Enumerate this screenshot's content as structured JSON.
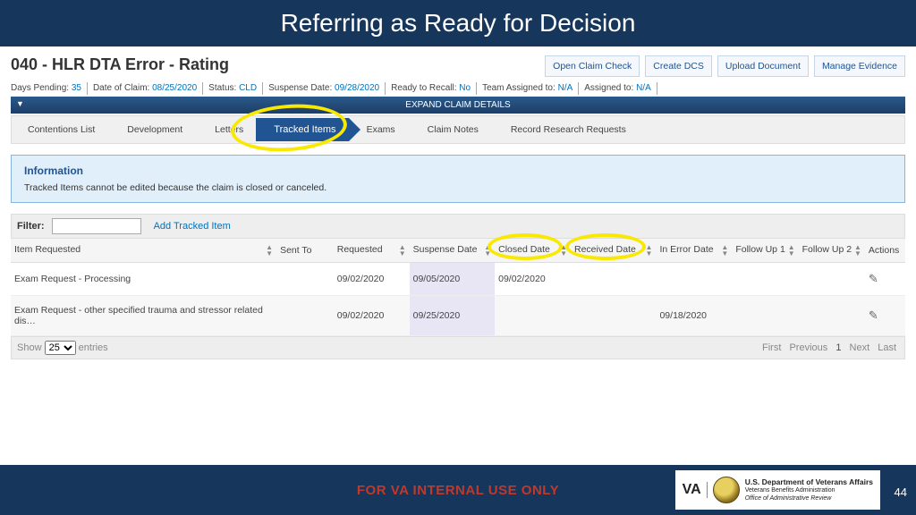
{
  "slide": {
    "title": "Referring as Ready for Decision",
    "number": "44"
  },
  "page": {
    "title": "040 - HLR DTA Error - Rating"
  },
  "actions": {
    "open": "Open Claim Check",
    "dcs": "Create DCS",
    "upload": "Upload Document",
    "evidence": "Manage Evidence"
  },
  "meta": {
    "days_pending_label": "Days Pending:",
    "days_pending_val": "35",
    "date_claim_label": "Date of Claim:",
    "date_claim_val": "08/25/2020",
    "status_label": "Status:",
    "status_val": "CLD",
    "suspense_label": "Suspense Date:",
    "suspense_val": "09/28/2020",
    "recall_label": "Ready to Recall:",
    "recall_val": "No",
    "team_label": "Team Assigned to:",
    "team_val": "N/A",
    "assigned_label": "Assigned to:",
    "assigned_val": "N/A"
  },
  "expand": "EXPAND CLAIM DETAILS",
  "tabs": {
    "contentions": "Contentions List",
    "development": "Development",
    "letters": "Letters",
    "tracked": "Tracked Items",
    "exams": "Exams",
    "notes": "Claim Notes",
    "research": "Record Research Requests"
  },
  "info": {
    "title": "Information",
    "text": "Tracked Items cannot be edited because the claim is closed or canceled."
  },
  "filter": {
    "label": "Filter:",
    "add": "Add Tracked Item"
  },
  "cols": {
    "item": "Item Requested",
    "sent": "Sent To",
    "requested": "Requested",
    "suspense": "Suspense Date",
    "closed": "Closed Date",
    "received": "Received Date",
    "error": "In Error Date",
    "f1": "Follow Up 1",
    "f2": "Follow Up 2",
    "actions": "Actions"
  },
  "rows": [
    {
      "item": "Exam Request - Processing",
      "requested": "09/02/2020",
      "suspense": "09/05/2020",
      "closed": "09/02/2020",
      "received": "",
      "error": ""
    },
    {
      "item": "Exam Request - other specified trauma and stressor related dis…",
      "requested": "09/02/2020",
      "suspense": "09/25/2020",
      "closed": "",
      "received": "",
      "error": "09/18/2020"
    }
  ],
  "pager": {
    "show": "Show",
    "entries": "entries",
    "per": "25",
    "first": "First",
    "prev": "Previous",
    "page": "1",
    "next": "Next",
    "last": "Last"
  },
  "footer": {
    "internal": "FOR VA INTERNAL USE ONLY",
    "va": "VA",
    "dept1": "U.S. Department of Veterans Affairs",
    "dept2": "Veterans Benefits Administration",
    "dept3": "Office of Administrative Review"
  }
}
